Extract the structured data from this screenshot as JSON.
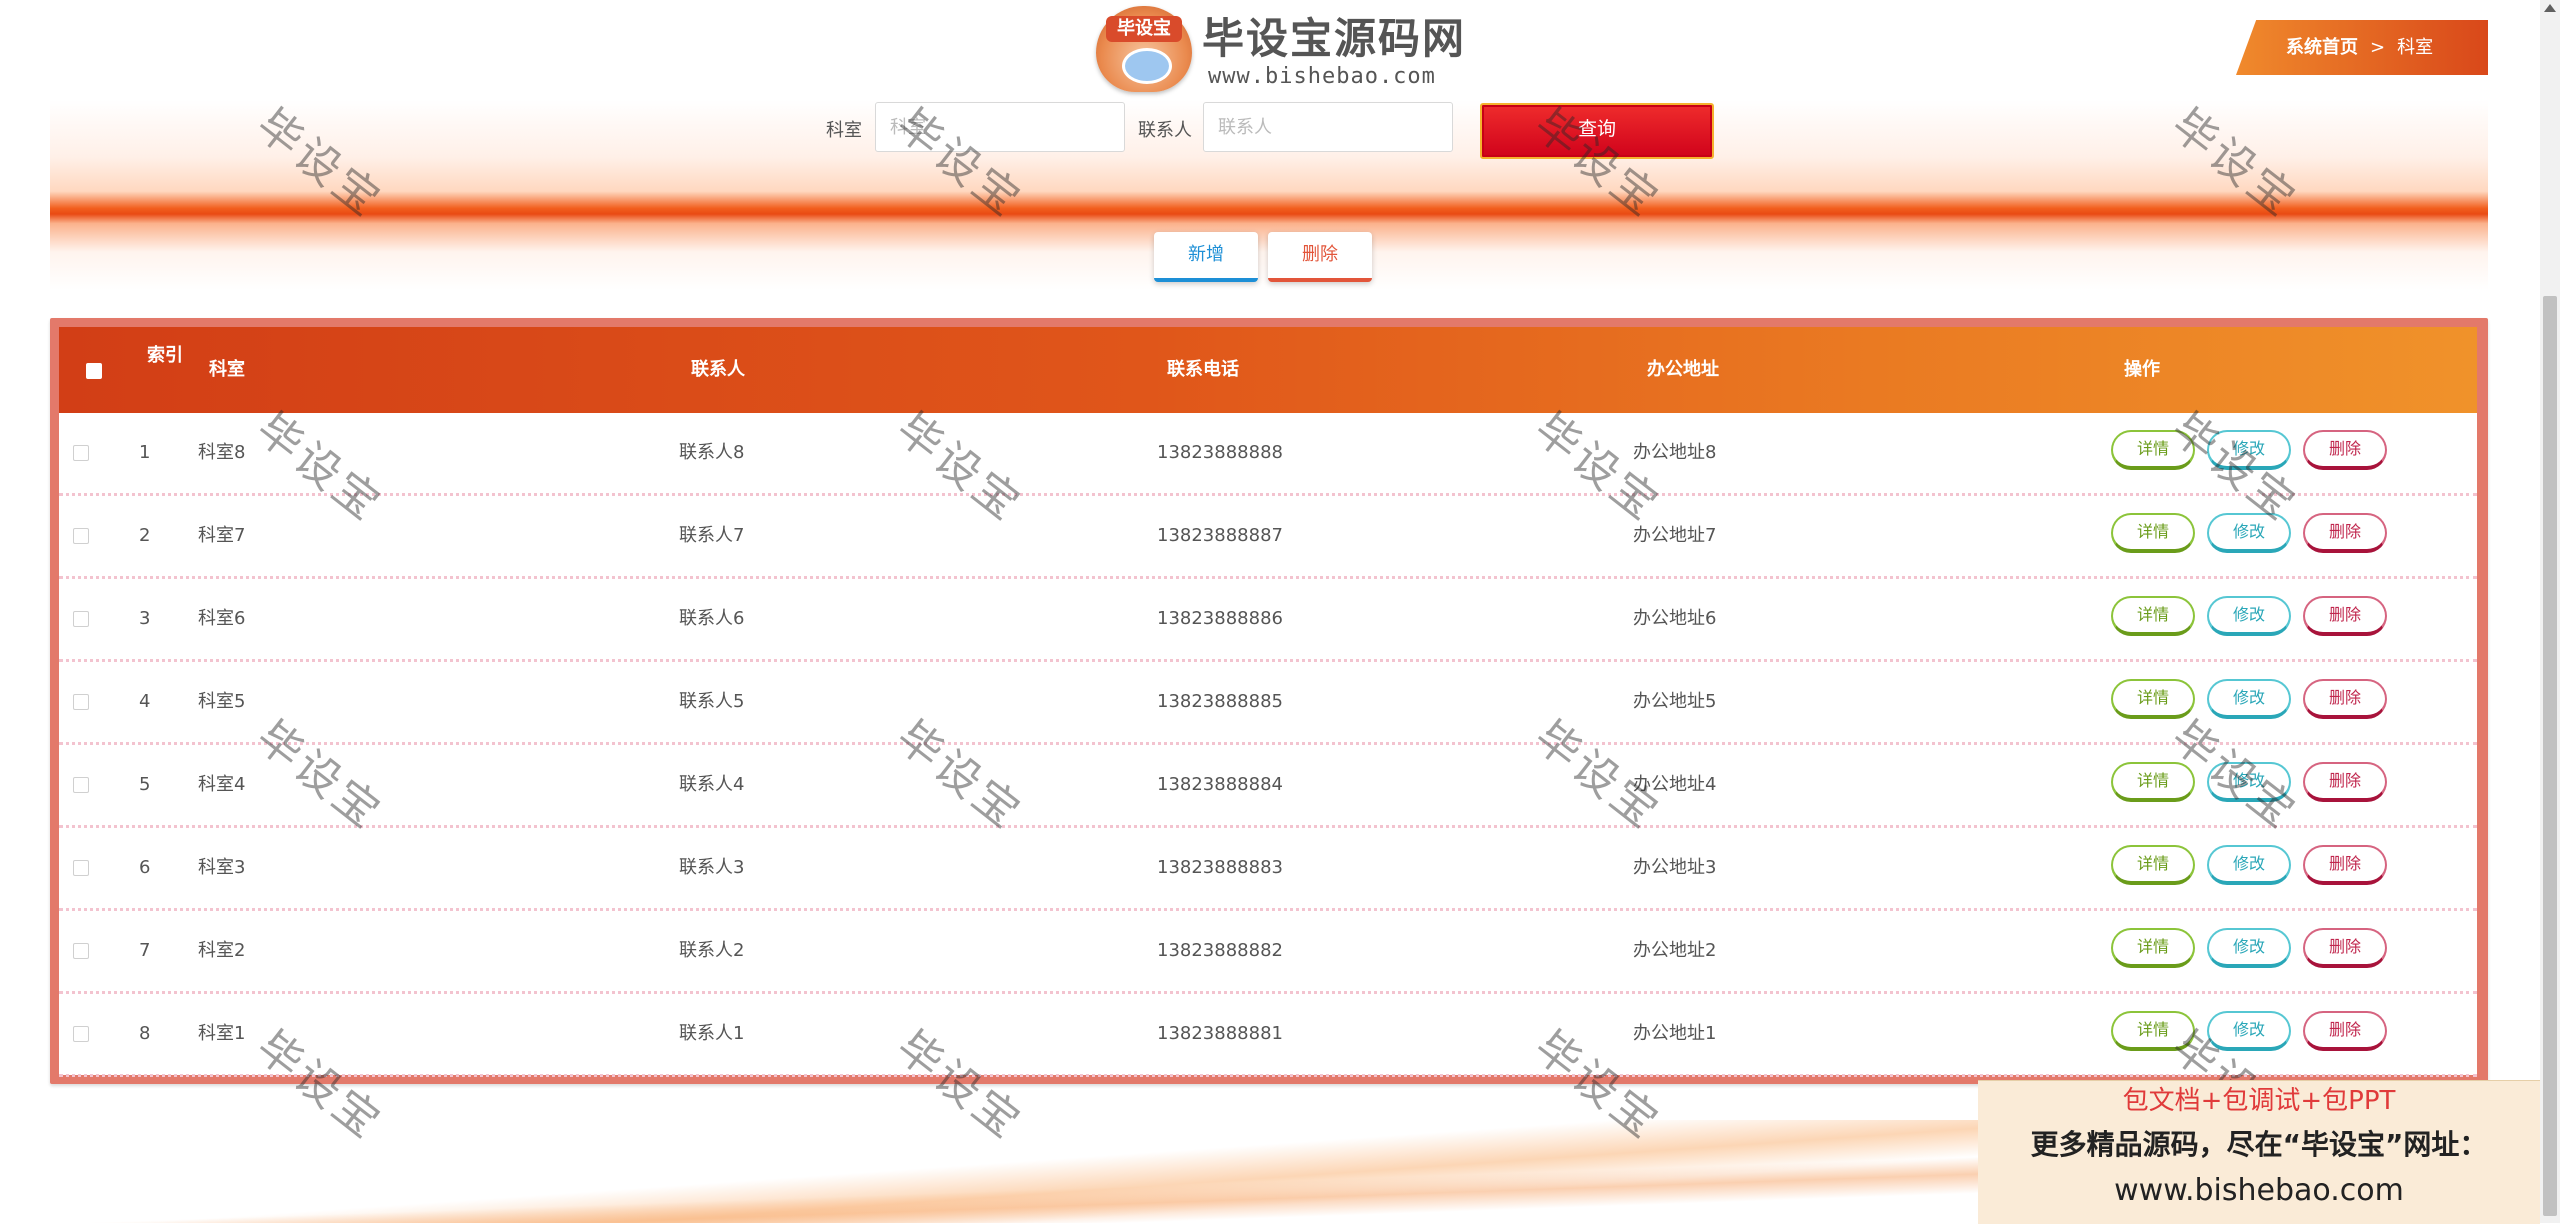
{
  "logo": {
    "badge_text": "毕设宝",
    "title": "毕设宝源码网",
    "url": "www.bishebao.com"
  },
  "breadcrumb": {
    "home": "系统首页",
    "separator": ">",
    "current": "科室"
  },
  "search": {
    "dept_label": "科室",
    "dept_placeholder": "科室",
    "contact_label": "联系人",
    "contact_placeholder": "联系人",
    "query_button": "查询"
  },
  "actions": {
    "add": "新增",
    "delete": "删除"
  },
  "table": {
    "headers": {
      "index": "索引",
      "dept": "科室",
      "contact": "联系人",
      "phone": "联系电话",
      "address": "办公地址",
      "ops": "操作"
    },
    "row_buttons": {
      "detail": "详情",
      "edit": "修改",
      "delete": "删除"
    },
    "rows": [
      {
        "index": "1",
        "dept": "科室8",
        "contact": "联系人8",
        "phone": "13823888888",
        "address": "办公地址8"
      },
      {
        "index": "2",
        "dept": "科室7",
        "contact": "联系人7",
        "phone": "13823888887",
        "address": "办公地址7"
      },
      {
        "index": "3",
        "dept": "科室6",
        "contact": "联系人6",
        "phone": "13823888886",
        "address": "办公地址6"
      },
      {
        "index": "4",
        "dept": "科室5",
        "contact": "联系人5",
        "phone": "13823888885",
        "address": "办公地址5"
      },
      {
        "index": "5",
        "dept": "科室4",
        "contact": "联系人4",
        "phone": "13823888884",
        "address": "办公地址4"
      },
      {
        "index": "6",
        "dept": "科室3",
        "contact": "联系人3",
        "phone": "13823888883",
        "address": "办公地址3"
      },
      {
        "index": "7",
        "dept": "科室2",
        "contact": "联系人2",
        "phone": "13823888882",
        "address": "办公地址2"
      },
      {
        "index": "8",
        "dept": "科室1",
        "contact": "联系人1",
        "phone": "13823888881",
        "address": "办公地址1"
      }
    ]
  },
  "watermark": {
    "text": "毕设宝"
  },
  "promo": {
    "line1": "包文档+包调试+包PPT",
    "line2": "更多精品源码，尽在“毕设宝”网址：",
    "line3": "www.bishebao.com"
  },
  "colors": {
    "header_gradient_start": "#d23e16",
    "header_gradient_end": "#f0922a",
    "query_button": "#d0021b",
    "add_button": "#1d8fd6",
    "delete_button": "#e2553a",
    "detail_pill": "#6a9c1a",
    "edit_pill": "#2aa7b8",
    "delete_pill": "#c0264d"
  }
}
